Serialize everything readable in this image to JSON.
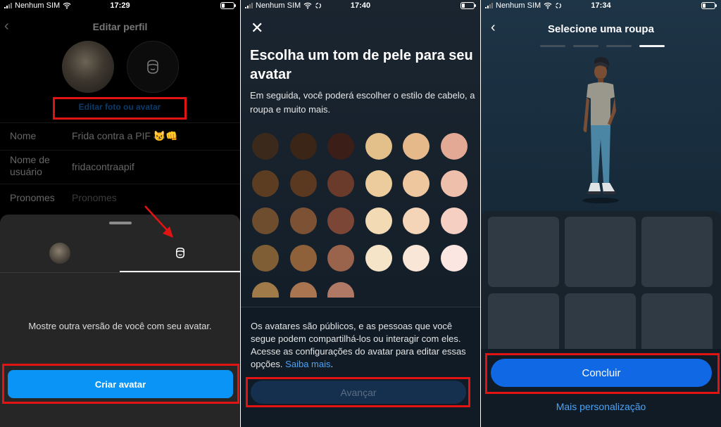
{
  "status": {
    "carrier": "Nenhum SIM",
    "time_1": "17:29",
    "time_2": "17:40",
    "time_3": "17:34"
  },
  "panel1": {
    "title": "Editar perfil",
    "edit_photo_link": "Editar foto ou avatar",
    "fields": [
      {
        "label": "Nome",
        "value": "Frida contra a PIF 😼👊"
      },
      {
        "label": "Nome de usuário",
        "value": "fridacontraapif"
      },
      {
        "label": "Pronomes",
        "placeholder": "Pronomes"
      }
    ],
    "sheet_description": "Mostre outra versão de você com seu avatar.",
    "create_button": "Criar avatar"
  },
  "panel2": {
    "title": "Escolha um tom de pele para seu avatar",
    "subtitle": "Em seguida, você poderá escolher o estilo de cabelo, a roupa e muito mais.",
    "skin_tones": [
      "#3b2a1c",
      "#3a2516",
      "#3a1e17",
      "#e3bf8a",
      "#e6b98a",
      "#e3a995",
      "#5c3d22",
      "#5b3820",
      "#6a3a2a",
      "#eccc9c",
      "#efc79e",
      "#eec0ac",
      "#6e4d2e",
      "#7d5234",
      "#7c4636",
      "#f2dab5",
      "#f4d5b8",
      "#f5cfc2",
      "#7f5e36",
      "#8f613b",
      "#9a634c",
      "#f6e4c9",
      "#f9e6d6",
      "#fbe6e2",
      "#a07a48",
      "#a97550",
      "#b07965"
    ],
    "footer_note": "Os avatares são públicos, e as pessoas que você segue podem compartilhá-los ou interagir com eles. Acesse as configurações do avatar para editar essas opções.",
    "learn_more": "Saiba mais",
    "advance_button": "Avançar"
  },
  "panel3": {
    "title": "Selecione uma roupa",
    "steps_total": 4,
    "steps_current": 4,
    "done_button": "Concluir",
    "more_link": "Mais personalização"
  },
  "colors": {
    "highlight": "#e21313",
    "primary_blue": "#0a95f6",
    "done_blue": "#1168e4",
    "link_blue": "#4ba3f7"
  }
}
